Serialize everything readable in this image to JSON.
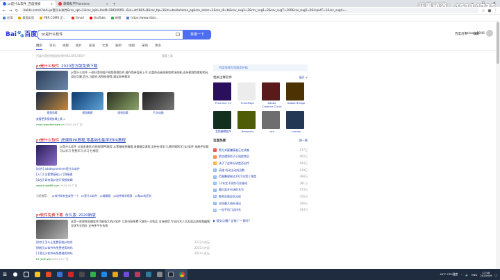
{
  "browser": {
    "tabs": [
      {
        "label": "pr是什么软件_百度搜索",
        "active": true
      },
      {
        "label": "草莓科学Premiere",
        "active": false
      }
    ],
    "url": "baidu.com/s?wd=pr是什么软件&rsv_spt=1&rsv_iqid=0xd0c38410000...&ie=utf-8&f=8&rsv_bp=1&tn=baiduhome_pg&rsv_enter=1&rsv_dl=tb&rsv_sug3=2&rsv_sug1=2&rsv_sug7=100&rsv_sug2=0&inputT=1&rsv_sug4=...",
    "bookmarks": [
      "应用",
      "表面实验",
      "PBR.COMS 正...",
      "Gmail",
      "YouTube",
      "地图",
      "https://www.ribbi..."
    ],
    "watermark": "开黑频道：45114735"
  },
  "page": {
    "logo_a": "Bai",
    "logo_b": "百度",
    "search_value": "pr是什么软件",
    "search_button": "百度一下",
    "top_links": [
      "百度首页",
      "设置"
    ],
    "user": "kaiwulg2046",
    "tabs": [
      "网页",
      "资讯",
      "视频",
      "图片",
      "知道",
      "文库",
      "贴吧",
      "地图",
      "采购",
      "更多"
    ],
    "meta": "百度为您找到相关结果约62,600,000个",
    "tool": "搜索工具",
    "results": [
      {
        "title_pre": "pr是什么软件",
        "title_post": "_2020官方版免费下载",
        "text": "pr是什么软件 一款好用的国产视频剪辑软件,操作简单容易上手,丰富的动画效果和转场效果,支持视频剪辑和转码,添加字幕,音乐,马赛克,视频处理等,满足各种需求",
        "images": [
          {
            "cap": "视频剪辑"
          },
          {
            "cap": "视频美颜"
          },
          {
            "cap": "高效剪辑"
          },
          {
            "cap": "片头动画"
          }
        ],
        "link2": "查看更多视频剪辑工具 >",
        "src": "miao.wondershare.cn",
        "date": "2020-09",
        "ad": "广告"
      },
      {
        "title_pre": "pr是什么软件",
        "title_post": "_虎课网PR教程,零基础也能学好PR教程",
        "text": "pr是什么软件 认准虎课网,在线视频PR教程 从零基础到精通,海量精品课程,支持在线学习,随时随地学习pr软件,电脑手机都可以学习 免费学习,学习 往哪里",
        "sub": [
          {
            "l": "[综合] adobepremiere是什么软件",
            "r": ""
          },
          {
            "l": "[入门] 全套零基础入门到精通",
            "r": ""
          },
          {
            "l": "[实战] 如何用pr进行视频剪辑",
            "r": ""
          }
        ],
        "src": "www.huke88.com",
        "date": "2020-09",
        "ad": "广告"
      },
      {
        "related": [
          "为您推荐：",
          "pr软件如何变成另一个",
          "pr是什么软件",
          "pr破解版",
          "pr软件教学视频",
          "pr和ae的区别"
        ]
      },
      {
        "title_pre": "pr软件免费下载",
        "title_post": "_永久版_2020新版",
        "text": "这是一款视频非编软件功能强大的pr软件 立即开始免费下载的一次购买 支持使用 专业技术人员及高品质视频编辑 全球专业团队 支持多平台系统",
        "sub": [
          {
            "l": "[软件] 怎么让免费获取pr软件",
            "r": "2233人在玩"
          },
          {
            "l": "[教程] pr软件有免费使用的吗",
            "r": "2233人在玩"
          },
          {
            "l": "[下载] pr软件有免费使用的吗",
            "r": "2014人在玩"
          }
        ],
        "src": "b7.yaie.vip",
        "date": "2020-09",
        "ad": "广告"
      }
    ],
    "right": {
      "banner": "百度保障为您搜索护航",
      "section": "相关注释软件",
      "more": "展开 ∨",
      "apps": [
        {
          "cap": "Premiere CC",
          "color": "#2a0f5c"
        },
        {
          "cap": "FrontPage",
          "color": "#ececec"
        },
        {
          "cap": "Adobe Creative Cloud",
          "color": "#5a1a1a"
        },
        {
          "cap": "Adobe Bridge",
          "color": "#4d3304"
        },
        {
          "cap": "音频编辑软件",
          "color": "#12301d"
        },
        {
          "cap": "fireworks",
          "color": "#4e5b07"
        },
        {
          "cap": "cad",
          "color": "#6e6e6e"
        },
        {
          "cap": "Lumion",
          "color": "#233854"
        }
      ],
      "hot_title": "百度热搜",
      "hot_more": "换一换",
      "hot": [
        {
          "t": "警方对疑嫌疑者正在调查",
          "c": "477万"
        },
        {
          "t": "航空遇到男子心肌疾病后",
          "c": "460万"
        },
        {
          "t": "孩子了这种分钟是否治疗",
          "c": "444万"
        },
        {
          "t": "英雄 机动出动成员数",
          "c": "419万"
        },
        {
          "t": "范围整理制式2021年第三季度",
          "c": "398万"
        },
        {
          "t": "13年女子男性引发乘电",
          "c": "391万"
        },
        {
          "t": "最后离开市场的名号",
          "c": "373万"
        },
        {
          "t": "教师家属部队出现",
          "c": "356万"
        },
        {
          "t": "全网最大海外演出",
          "c": "346万"
        },
        {
          "t": "一加手机门店排名",
          "c": "334万"
        }
      ],
      "bottom": "▶ 提交点播广告推广一直吗?"
    }
  },
  "taskbar": {
    "weather": "49°C CPU温度",
    "lang": "ENG",
    "time": "17:06",
    "date": "2020/9/9"
  }
}
